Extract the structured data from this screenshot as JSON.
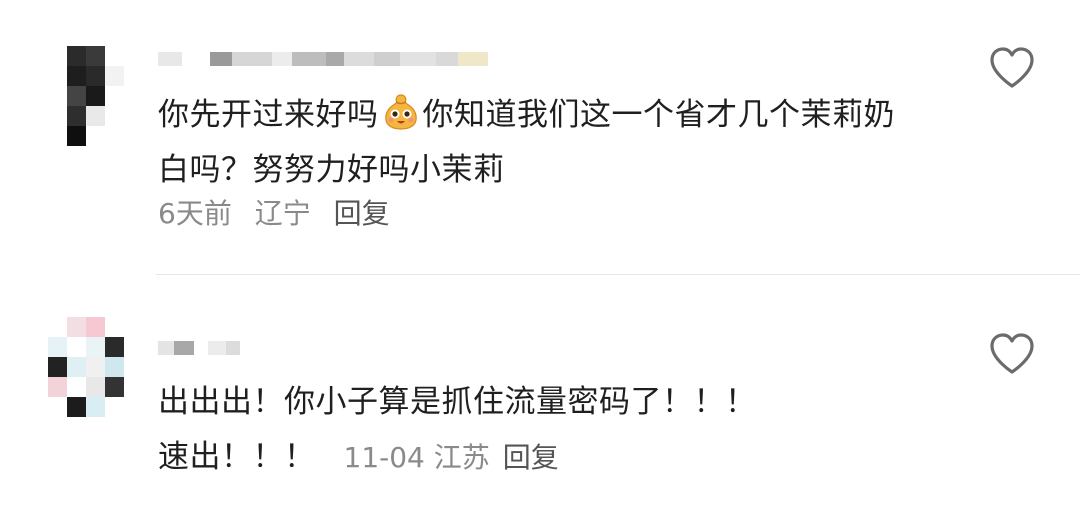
{
  "comments": [
    {
      "text_part1": "你先开过来好吗",
      "emoji": "smiling-bag-emoji",
      "text_part2": "你知道我们这一个省才几个茉莉奶白吗？努努力好吗小茉莉",
      "time": "6天前",
      "location": "辽宁",
      "reply_label": "回复",
      "like_icon": "heart-outline-icon"
    },
    {
      "text_line1": "出出出！你小子算是抓住流量密码了！！！",
      "text_line2": "速出！！！",
      "time": "11-04",
      "location": "江苏",
      "reply_label": "回复",
      "like_icon": "heart-outline-icon"
    }
  ],
  "colors": {
    "text": "#1f1f1f",
    "meta": "#8a8a8a",
    "reply": "#555555",
    "divider": "#e6e6e6",
    "icon": "#6b6b6b"
  }
}
